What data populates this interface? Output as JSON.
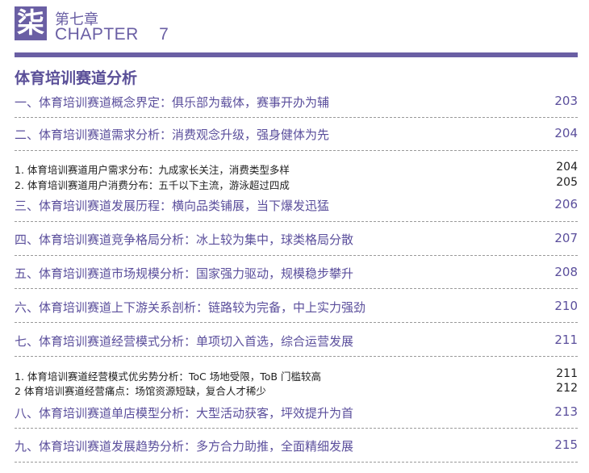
{
  "header": {
    "badge": "柒",
    "chapter_cn": "第七章",
    "chapter_en": "CHAPTER    7"
  },
  "section_title": "体育培训赛道分析",
  "entries": [
    {
      "label": "一、体育培训赛道概念界定：俱乐部为载体，赛事开办为辅",
      "page": "203"
    },
    {
      "label": "二、体育培训赛道需求分析：消费观念升级，强身健体为先",
      "page": "204"
    },
    {
      "label": "1. 体育培训赛道用户需求分布：九成家长关注，消费类型多样",
      "page": "204"
    },
    {
      "label": "2. 体育培训赛道用户消费分布：五千以下主流，游泳超过四成",
      "page": "205"
    },
    {
      "label": "三、体育培训赛道发展历程：横向品类铺展，当下爆发迅猛",
      "page": "206"
    },
    {
      "label": "四、体育培训赛道竞争格局分析：冰上较为集中，球类格局分散",
      "page": "207"
    },
    {
      "label": "五、体育培训赛道市场规模分析：国家强力驱动，规模稳步攀升",
      "page": "208"
    },
    {
      "label": "六、体育培训赛道上下游关系剖析：链路较为完备，中上实力强劲",
      "page": "210"
    },
    {
      "label": "七、体育培训赛道经营模式分析：单项切入首选，综合运营发展",
      "page": "211"
    },
    {
      "label": "1. 体育培训赛道经营模式优劣势分析：ToC 场地受限，ToB 门槛较高",
      "page": "211"
    },
    {
      "label": "2 体育培训赛道经营痛点：场馆资源短缺，复合人才稀少",
      "page": "212"
    },
    {
      "label": "八、体育培训赛道单店模型分析：大型活动获客，坪效提升为首",
      "page": "213"
    },
    {
      "label": "九、体育培训赛道发展趋势分析：多方合力助推，全面精细发展",
      "page": "215"
    }
  ]
}
